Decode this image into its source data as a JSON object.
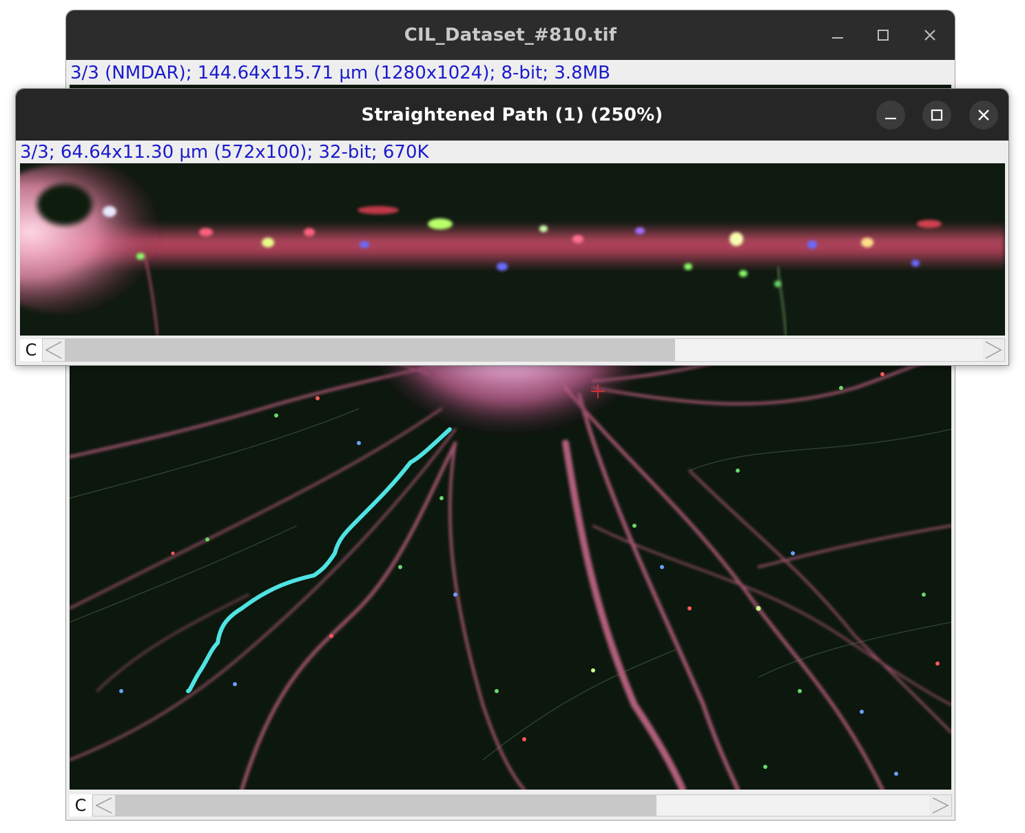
{
  "back_window": {
    "title": "CIL_Dataset_#810.tif",
    "info": "3/3 (NMDAR); 144.64x115.71 µm (1280x1024); 8-bit; 3.8MB",
    "channel_label": "C",
    "controls": {
      "minimize": "minimize-icon",
      "maximize": "maximize-icon",
      "close": "close-icon"
    },
    "path_color": "#4fe3e3"
  },
  "front_window": {
    "title": "Straightened Path (1) (250%)",
    "info": "3/3; 64.64x11.30 µm (572x100); 32-bit; 670K",
    "channel_label": "C",
    "controls": {
      "minimize": "minimize-icon",
      "maximize": "maximize-icon",
      "close": "close-icon"
    }
  }
}
